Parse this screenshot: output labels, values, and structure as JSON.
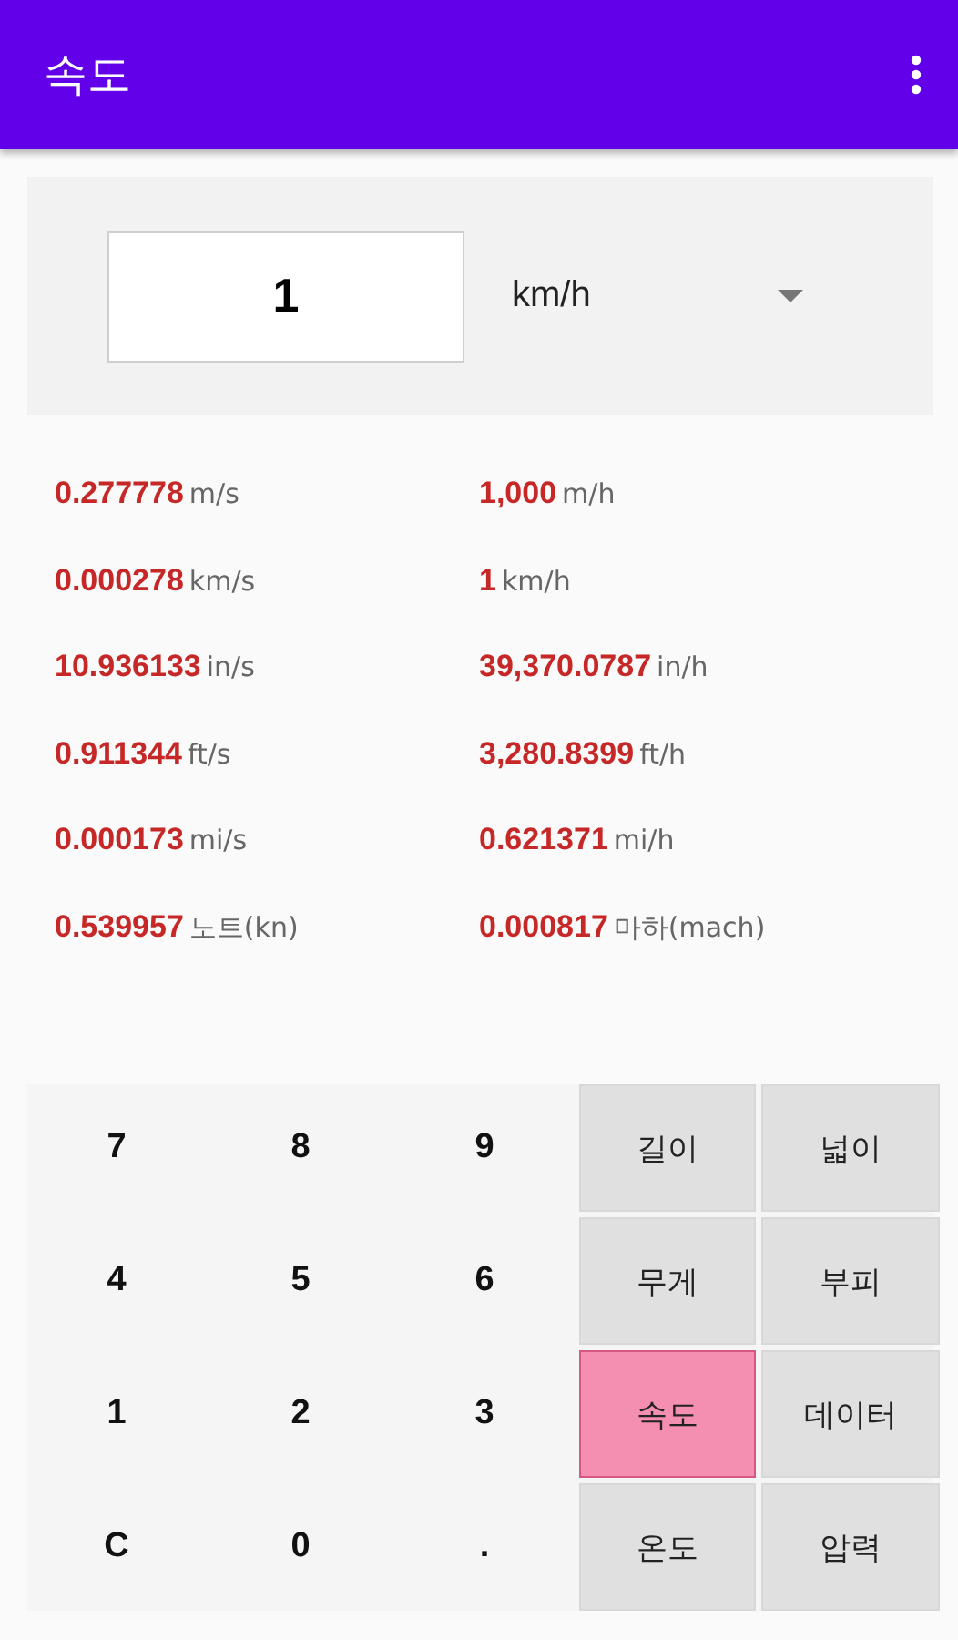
{
  "app_bar": {
    "title": "속도"
  },
  "input": {
    "value": "1",
    "unit": "km/h"
  },
  "results": [
    {
      "value": "0.277778",
      "unit": "m/s"
    },
    {
      "value": "1,000",
      "unit": "m/h"
    },
    {
      "value": "0.000278",
      "unit": "km/s"
    },
    {
      "value": "1",
      "unit": "km/h"
    },
    {
      "value": "10.936133",
      "unit": "in/s"
    },
    {
      "value": "39,370.0787",
      "unit": "in/h"
    },
    {
      "value": "0.911344",
      "unit": "ft/s"
    },
    {
      "value": "3,280.8399",
      "unit": "ft/h"
    },
    {
      "value": "0.000173",
      "unit": "mi/s"
    },
    {
      "value": "0.621371",
      "unit": "mi/h"
    },
    {
      "value": "0.539957",
      "unit": "노트(kn)"
    },
    {
      "value": "0.000817",
      "unit": "마하(mach)"
    }
  ],
  "keypad": [
    {
      "kind": "digit",
      "label": "7"
    },
    {
      "kind": "digit",
      "label": "8"
    },
    {
      "kind": "digit",
      "label": "9"
    },
    {
      "kind": "category",
      "label": "길이",
      "selected": false
    },
    {
      "kind": "category",
      "label": "넓이",
      "selected": false
    },
    {
      "kind": "digit",
      "label": "4"
    },
    {
      "kind": "digit",
      "label": "5"
    },
    {
      "kind": "digit",
      "label": "6"
    },
    {
      "kind": "category",
      "label": "무게",
      "selected": false
    },
    {
      "kind": "category",
      "label": "부피",
      "selected": false
    },
    {
      "kind": "digit",
      "label": "1"
    },
    {
      "kind": "digit",
      "label": "2"
    },
    {
      "kind": "digit",
      "label": "3"
    },
    {
      "kind": "category",
      "label": "속도",
      "selected": true
    },
    {
      "kind": "category",
      "label": "데이터",
      "selected": false
    },
    {
      "kind": "digit",
      "label": "C"
    },
    {
      "kind": "digit",
      "label": "0"
    },
    {
      "kind": "digit",
      "label": "."
    },
    {
      "kind": "category",
      "label": "온도",
      "selected": false
    },
    {
      "kind": "category",
      "label": "압력",
      "selected": false
    }
  ]
}
